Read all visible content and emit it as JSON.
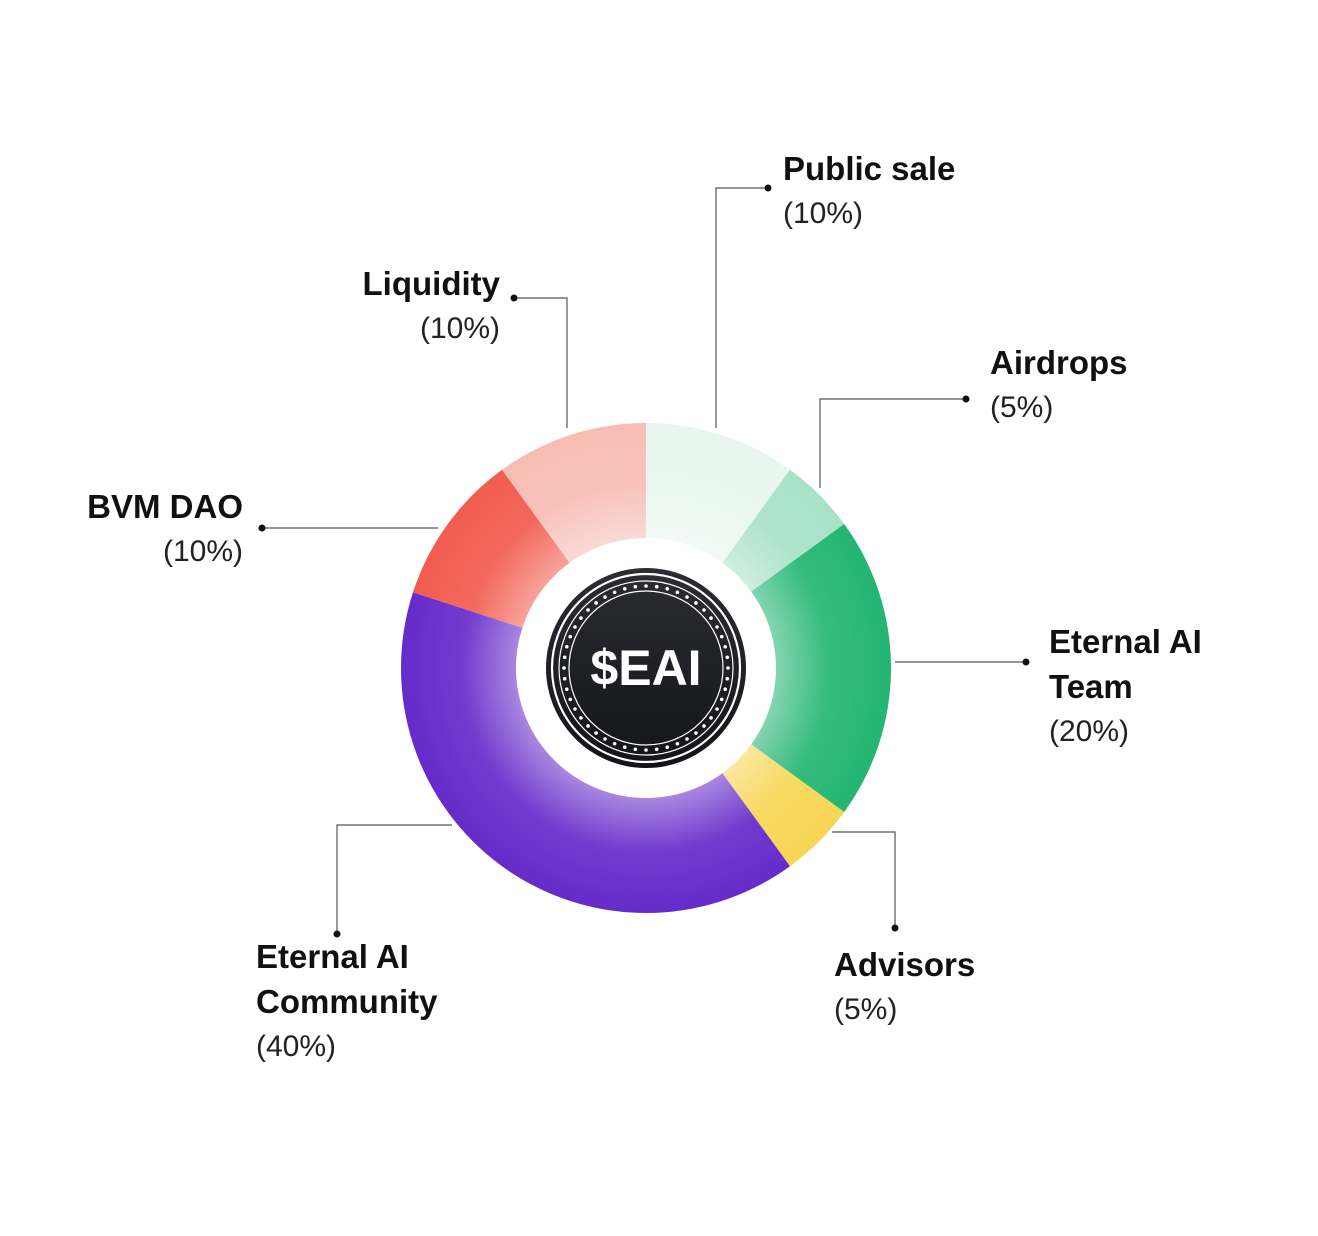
{
  "chart_data": {
    "type": "pie",
    "center_label": "$EAI",
    "slices": [
      {
        "label": "Public sale",
        "name_lines": [
          "Public sale"
        ],
        "percent_text": "(10%)",
        "value": 10,
        "color": "#e8f6ef"
      },
      {
        "label": "Airdrops",
        "name_lines": [
          "Airdrops"
        ],
        "percent_text": "(5%)",
        "value": 5,
        "color": "#a8e2c6"
      },
      {
        "label": "Eternal AI Team",
        "name_lines": [
          "Eternal AI",
          "Team"
        ],
        "percent_text": "(20%)",
        "value": 20,
        "color": "#24b573"
      },
      {
        "label": "Advisors",
        "name_lines": [
          "Advisors"
        ],
        "percent_text": "(5%)",
        "value": 5,
        "color": "#f7d654"
      },
      {
        "label": "Eternal AI Community",
        "name_lines": [
          "Eternal AI",
          "Community"
        ],
        "percent_text": "(40%)",
        "value": 40,
        "color": "#662bca"
      },
      {
        "label": "BVM DAO",
        "name_lines": [
          "BVM DAO"
        ],
        "percent_text": "(10%)",
        "value": 10,
        "color": "#f25c4f"
      },
      {
        "label": "Liquidity",
        "name_lines": [
          "Liquidity"
        ],
        "percent_text": "(10%)",
        "value": 10,
        "color": "#f7bdb5"
      }
    ]
  }
}
